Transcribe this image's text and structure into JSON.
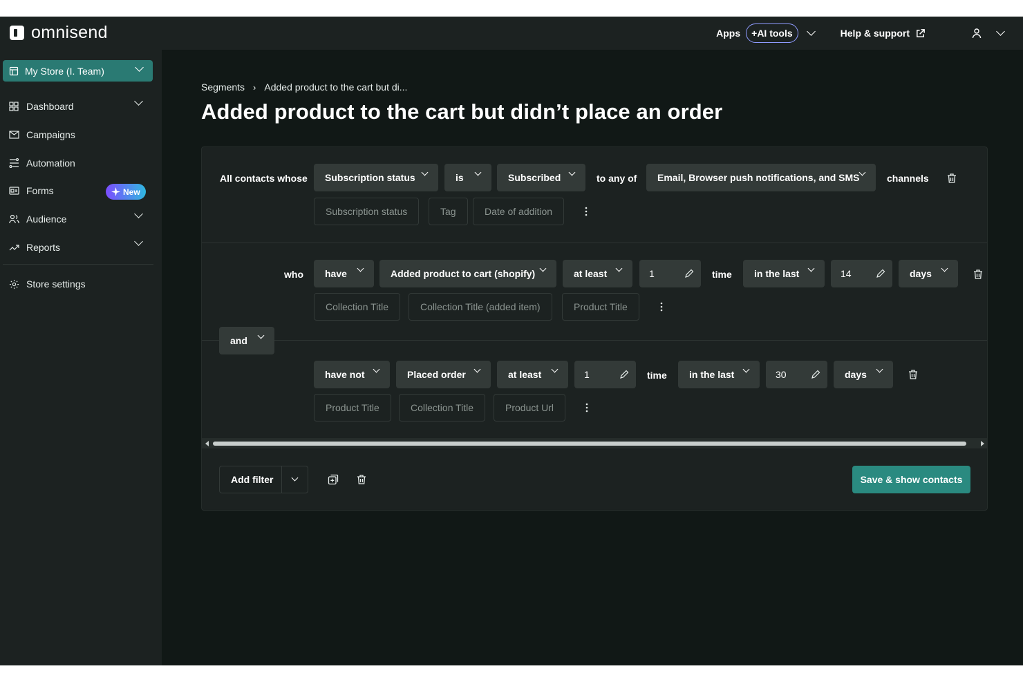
{
  "brand": {
    "name": "omnisend"
  },
  "topbar": {
    "apps_label": "Apps",
    "ai_tools_label": "+AI tools",
    "help_label": "Help & support"
  },
  "sidebar": {
    "store_label": "My Store (I. Team)",
    "items": [
      {
        "label": "Dashboard"
      },
      {
        "label": "Campaigns"
      },
      {
        "label": "Automation"
      },
      {
        "label": "Forms",
        "badge": "New"
      },
      {
        "label": "Audience"
      },
      {
        "label": "Reports"
      }
    ],
    "settings_label": "Store settings"
  },
  "breadcrumb": {
    "root": "Segments",
    "separator": "›",
    "current": "Added product to the cart but di..."
  },
  "page": {
    "title": "Added product to the cart but didn’t place an order"
  },
  "filter1": {
    "prefix": "All contacts whose",
    "field": "Subscription status",
    "operator": "is",
    "value": "Subscribed",
    "connector": "to any of",
    "channels": "Email, Browser push notifications, and SMS",
    "suffix": "channels",
    "chips": [
      "Subscription status",
      "Tag",
      "Date of addition"
    ]
  },
  "filter2": {
    "prefix": "who",
    "verb": "have",
    "event": "Added product to cart (shopify)",
    "quantifier": "at least",
    "count": "1",
    "count_unit": "time",
    "period": "in the last",
    "period_value": "14",
    "period_unit": "days",
    "chips": [
      "Collection Title",
      "Collection Title (added item)",
      "Product Title"
    ]
  },
  "joiner": {
    "label": "and"
  },
  "filter3": {
    "verb": "have not",
    "event": "Placed order",
    "quantifier": "at least",
    "count": "1",
    "count_unit": "time",
    "period": "in the last",
    "period_value": "30",
    "period_unit": "days",
    "chips": [
      "Product Title",
      "Collection Title",
      "Product Url"
    ]
  },
  "footer": {
    "add_filter_label": "Add filter",
    "save_label": "Save & show contacts"
  },
  "colors": {
    "accent": "#2a8a80",
    "store_bg": "#2a7a73",
    "ai_border": "#8f9bff"
  }
}
